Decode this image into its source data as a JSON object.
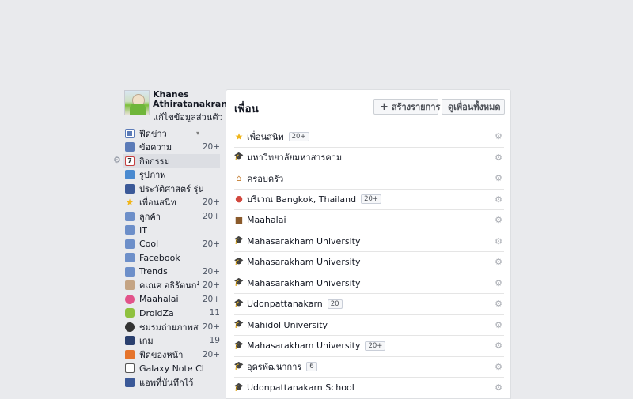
{
  "profile": {
    "name": "Khanes Athiratanakran",
    "edit_link": "แก้ไขข้อมูลส่วนตัว"
  },
  "nav": [
    {
      "label": "ฟีดข่าว",
      "count": "",
      "icon": "news-feed-icon",
      "caret": "▾"
    },
    {
      "label": "ข้อความ",
      "count": "20+",
      "icon": "messages-icon"
    },
    {
      "label": "กิจกรรม",
      "count": "",
      "icon": "events-calendar-icon",
      "icon_text": "7",
      "selected": true
    },
    {
      "label": "รูปภาพ",
      "count": "",
      "icon": "photos-icon"
    },
    {
      "label": "ประวัติศาสตร์ รุ่น1...",
      "count": "",
      "icon": "group-icon"
    },
    {
      "label": "เพื่อนสนิท",
      "count": "20+",
      "icon": "star-icon"
    },
    {
      "label": "ลูกค้า",
      "count": "20+",
      "icon": "feed-list-icon"
    },
    {
      "label": "IT",
      "count": "",
      "icon": "feed-list-icon"
    },
    {
      "label": "Cool",
      "count": "20+",
      "icon": "feed-list-icon"
    },
    {
      "label": "Facebook",
      "count": "",
      "icon": "feed-list-icon"
    },
    {
      "label": "Trends",
      "count": "20+",
      "icon": "feed-list-icon"
    },
    {
      "label": "คเณศ อธิรัตนกร้...",
      "count": "20+",
      "icon": "user-icon"
    },
    {
      "label": "Maahalai",
      "count": "20+",
      "icon": "app-icon"
    },
    {
      "label": "DroidZa",
      "count": "11",
      "icon": "android-icon"
    },
    {
      "label": "ชมรมถ่ายภาพส...",
      "count": "20+",
      "icon": "camera-icon"
    },
    {
      "label": "เกม",
      "count": "19",
      "icon": "game-icon"
    },
    {
      "label": "ฟีดของหน้า",
      "count": "20+",
      "icon": "pages-feed-icon"
    },
    {
      "label": "Galaxy Note Clu...",
      "count": "",
      "icon": "book-icon"
    },
    {
      "label": "แอพที่บันทึกไว้",
      "count": "",
      "icon": "bookmark-icon"
    }
  ],
  "main": {
    "title": "เพื่อน",
    "create_button": "สร้างรายการ",
    "create_button_icon": "+",
    "all_friends_button": "ดูเพื่อนทั้งหมด",
    "lists": [
      {
        "label": "เพื่อนสนิท",
        "badge": "20+",
        "icon": "star-icon",
        "glyph": "★"
      },
      {
        "label": "มหาวิทยาลัยมหาสารคาม",
        "badge": "",
        "icon": "graduation-cap-icon",
        "glyph": "🎓"
      },
      {
        "label": "ครอบครัว",
        "badge": "",
        "icon": "home-icon",
        "glyph": "⌂"
      },
      {
        "label": "บริเวณ Bangkok, Thailand",
        "badge": "20+",
        "icon": "location-pin-icon",
        "glyph": "●"
      },
      {
        "label": "Maahalai",
        "badge": "",
        "icon": "briefcase-icon",
        "glyph": "■"
      },
      {
        "label": "Mahasarakham University",
        "badge": "",
        "icon": "graduation-cap-icon",
        "glyph": "🎓"
      },
      {
        "label": "Mahasarakham University",
        "badge": "",
        "icon": "graduation-cap-icon",
        "glyph": "🎓"
      },
      {
        "label": "Mahasarakham University",
        "badge": "",
        "icon": "graduation-cap-icon",
        "glyph": "🎓"
      },
      {
        "label": "Udonpattanakarn",
        "badge": "20",
        "icon": "graduation-cap-icon",
        "glyph": "🎓"
      },
      {
        "label": "Mahidol University",
        "badge": "",
        "icon": "graduation-cap-icon",
        "glyph": "🎓"
      },
      {
        "label": "Mahasarakham University",
        "badge": "20+",
        "icon": "graduation-cap-icon",
        "glyph": "🎓"
      },
      {
        "label": "อุดรพัฒนาการ",
        "badge": "6",
        "icon": "graduation-cap-icon",
        "glyph": "🎓"
      },
      {
        "label": "Udonpattanakarn School",
        "badge": "",
        "icon": "graduation-cap-icon",
        "glyph": "🎓"
      }
    ]
  },
  "colors": {
    "background": "#e9eaed",
    "panel": "#ffffff",
    "selected_nav": "#dcdee3",
    "text": "#141823",
    "badge_border": "#c9ced8"
  }
}
